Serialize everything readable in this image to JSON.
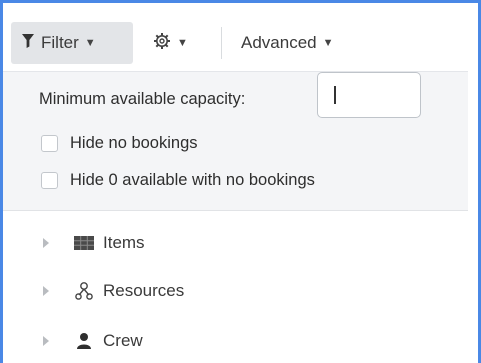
{
  "toolbar": {
    "filter_label": "Filter",
    "advanced_label": "Advanced",
    "filter_icon": "filter-funnel-icon",
    "settings_icon": "gear-icon",
    "caret_icon": "caret-down-icon"
  },
  "filter_panel": {
    "min_capacity_label": "Minimum available capacity:",
    "min_capacity_value": "",
    "checkboxes": [
      {
        "label": "Hide no bookings",
        "checked": false
      },
      {
        "label": "Hide 0 available with no bookings",
        "checked": false
      }
    ]
  },
  "tree": {
    "items": [
      {
        "label": "Items",
        "icon": "grid-icon",
        "expanded": false
      },
      {
        "label": "Resources",
        "icon": "resources-icon",
        "expanded": false
      },
      {
        "label": "Crew",
        "icon": "person-icon",
        "expanded": false
      }
    ]
  },
  "colors": {
    "accent_border": "#4a88e6",
    "panel_bg": "#f4f5f7",
    "toolbar_active_bg": "#e3e5e8"
  }
}
